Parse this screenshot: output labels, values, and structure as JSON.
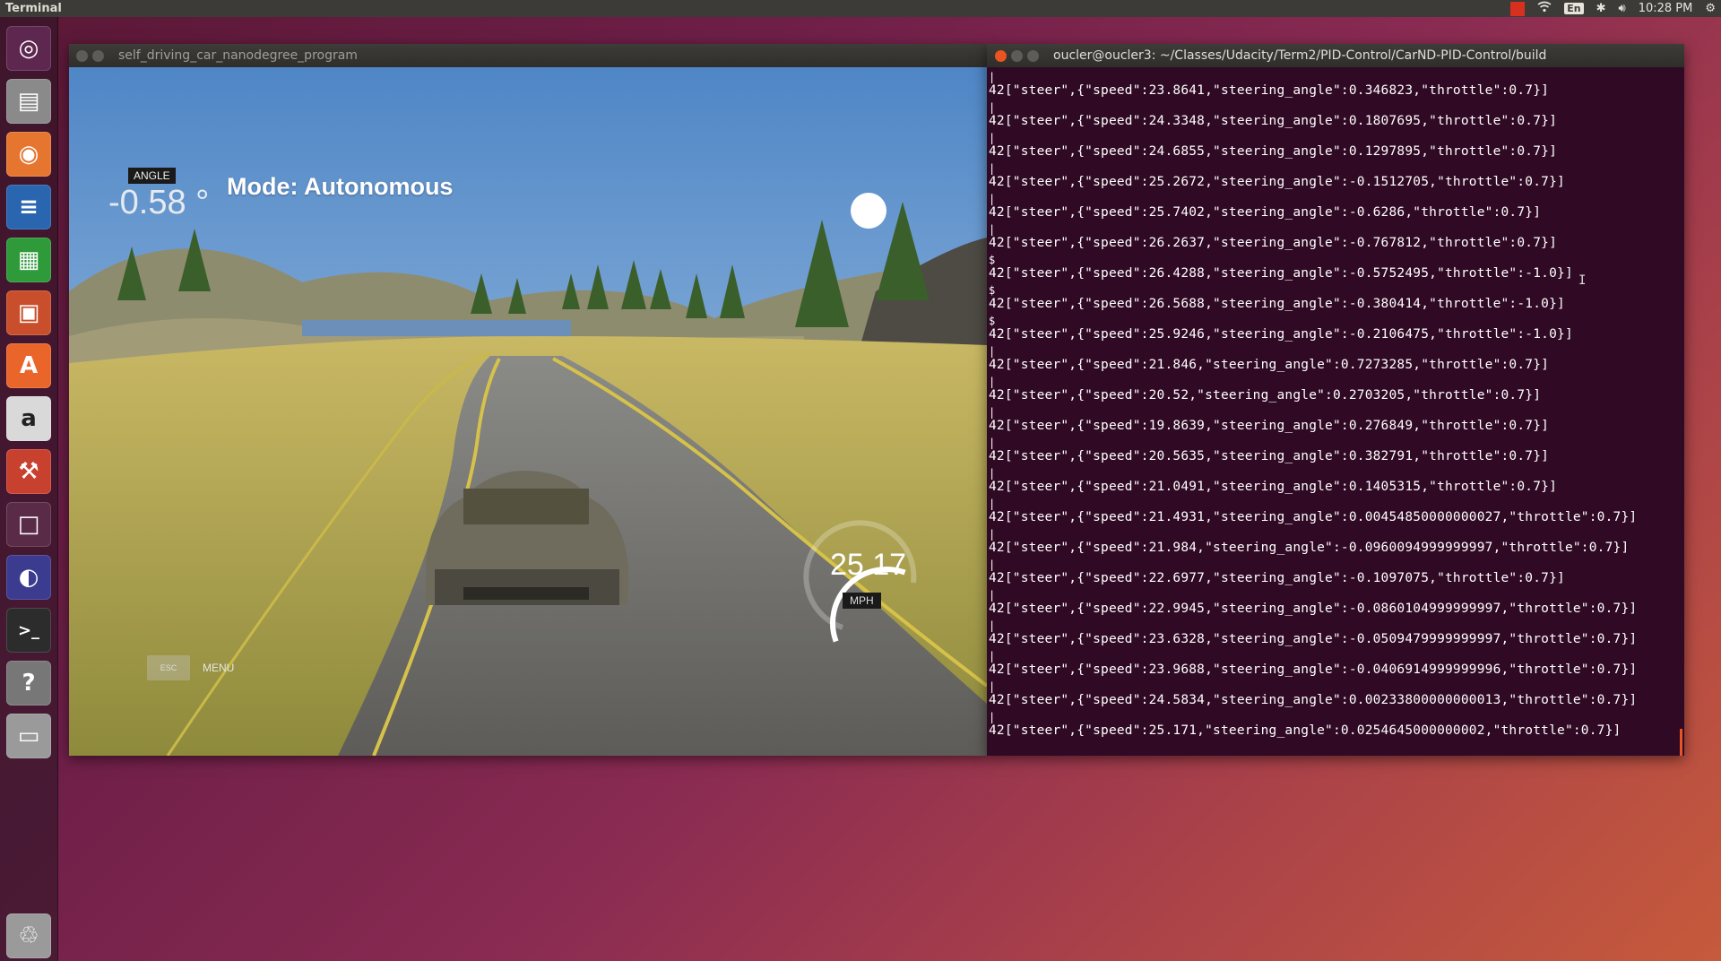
{
  "panel": {
    "app_title": "Terminal",
    "clock": "10:28 PM",
    "language": "En",
    "indicators": [
      "record-icon",
      "wifi-icon",
      "keyboard-layout-icon",
      "bluetooth-icon",
      "volume-icon",
      "settings-gear-icon"
    ]
  },
  "launcher": {
    "items": [
      {
        "name": "ubuntu-dash",
        "icon": "ubuntu-logo-icon",
        "color": "#5e2750"
      },
      {
        "name": "files",
        "icon": "file-cabinet-icon",
        "color": "#8a8a8a"
      },
      {
        "name": "firefox",
        "icon": "firefox-icon",
        "color": "#e6762f"
      },
      {
        "name": "libreoffice-writer",
        "icon": "writer-document-icon",
        "color": "#2a65b0"
      },
      {
        "name": "libreoffice-calc",
        "icon": "calc-spreadsheet-icon",
        "color": "#2e9a3a"
      },
      {
        "name": "libreoffice-impress",
        "icon": "impress-slides-icon",
        "color": "#c94f2c"
      },
      {
        "name": "ubuntu-software",
        "icon": "shopping-bag-icon",
        "color": "#e9652a"
      },
      {
        "name": "amazon",
        "icon": "amazon-icon",
        "color": "#d9d9d9"
      },
      {
        "name": "system-settings",
        "icon": "wrench-gear-icon",
        "color": "#c8402e"
      },
      {
        "name": "workspace-switcher",
        "icon": "workspaces-icon",
        "color": "#5a2b47"
      },
      {
        "name": "eclipse",
        "icon": "eclipse-sphere-icon",
        "color": "#3b3b8f"
      },
      {
        "name": "terminal",
        "icon": "terminal-prompt-icon",
        "color": "#2c2c2c"
      },
      {
        "name": "help",
        "icon": "question-mark-icon",
        "color": "#777777"
      },
      {
        "name": "drive",
        "icon": "drive-icon",
        "color": "#9a9a9a"
      },
      {
        "name": "trash",
        "icon": "trash-icon",
        "color": "#9a9a9a"
      }
    ]
  },
  "sim_window": {
    "title": "self_driving_car_nanodegree_program",
    "hud": {
      "angle_label": "ANGLE",
      "angle_value": "-0.58 °",
      "mode": "Mode: Autonomous",
      "speed": "25.17",
      "speed_unit": "MPH",
      "esc": "ESC",
      "menu": "MENU",
      "speed_gauge_fraction": 0.5
    }
  },
  "term_window": {
    "title": "oucler@oucler3: ~/Classes/Udacity/Term2/PID-Control/CarND-PID-Control/build",
    "lines": [
      {
        "pre": "|",
        "text": "42[\"steer\",{\"speed\":23.8641,\"steering_angle\":0.346823,\"throttle\":0.7}]"
      },
      {
        "pre": "|",
        "text": "42[\"steer\",{\"speed\":24.3348,\"steering_angle\":0.1807695,\"throttle\":0.7}]"
      },
      {
        "pre": "|",
        "text": "42[\"steer\",{\"speed\":24.6855,\"steering_angle\":0.1297895,\"throttle\":0.7}]"
      },
      {
        "pre": "|",
        "text": "42[\"steer\",{\"speed\":25.2672,\"steering_angle\":-0.1512705,\"throttle\":0.7}]"
      },
      {
        "pre": "|",
        "text": "42[\"steer\",{\"speed\":25.7402,\"steering_angle\":-0.6286,\"throttle\":0.7}]"
      },
      {
        "pre": "|",
        "text": "42[\"steer\",{\"speed\":26.2637,\"steering_angle\":-0.767812,\"throttle\":0.7}]"
      },
      {
        "pre": "$",
        "text": "42[\"steer\",{\"speed\":26.4288,\"steering_angle\":-0.5752495,\"throttle\":-1.0}]"
      },
      {
        "pre": "$",
        "text": "42[\"steer\",{\"speed\":26.5688,\"steering_angle\":-0.380414,\"throttle\":-1.0}]"
      },
      {
        "pre": "$",
        "text": "42[\"steer\",{\"speed\":25.9246,\"steering_angle\":-0.2106475,\"throttle\":-1.0}]"
      },
      {
        "pre": "|",
        "text": "42[\"steer\",{\"speed\":21.846,\"steering_angle\":0.7273285,\"throttle\":0.7}]"
      },
      {
        "pre": "|",
        "text": "42[\"steer\",{\"speed\":20.52,\"steering_angle\":0.2703205,\"throttle\":0.7}]"
      },
      {
        "pre": "|",
        "text": "42[\"steer\",{\"speed\":19.8639,\"steering_angle\":0.276849,\"throttle\":0.7}]"
      },
      {
        "pre": "|",
        "text": "42[\"steer\",{\"speed\":20.5635,\"steering_angle\":0.382791,\"throttle\":0.7}]"
      },
      {
        "pre": "|",
        "text": "42[\"steer\",{\"speed\":21.0491,\"steering_angle\":0.1405315,\"throttle\":0.7}]"
      },
      {
        "pre": "|",
        "text": "42[\"steer\",{\"speed\":21.4931,\"steering_angle\":0.00454850000000027,\"throttle\":0.7}]"
      },
      {
        "pre": "|",
        "text": "42[\"steer\",{\"speed\":21.984,\"steering_angle\":-0.0960094999999997,\"throttle\":0.7}]"
      },
      {
        "pre": "|",
        "text": "42[\"steer\",{\"speed\":22.6977,\"steering_angle\":-0.1097075,\"throttle\":0.7}]"
      },
      {
        "pre": "|",
        "text": "42[\"steer\",{\"speed\":22.9945,\"steering_angle\":-0.0860104999999997,\"throttle\":0.7}]"
      },
      {
        "pre": "|",
        "text": "42[\"steer\",{\"speed\":23.6328,\"steering_angle\":-0.0509479999999997,\"throttle\":0.7}]"
      },
      {
        "pre": "|",
        "text": "42[\"steer\",{\"speed\":23.9688,\"steering_angle\":-0.0406914999999996,\"throttle\":0.7}]"
      },
      {
        "pre": "|",
        "text": "42[\"steer\",{\"speed\":24.5834,\"steering_angle\":0.00233800000000013,\"throttle\":0.7}]"
      },
      {
        "pre": "|",
        "text": "42[\"steer\",{\"speed\":25.171,\"steering_angle\":0.0254645000000002,\"throttle\":0.7}]"
      }
    ]
  }
}
